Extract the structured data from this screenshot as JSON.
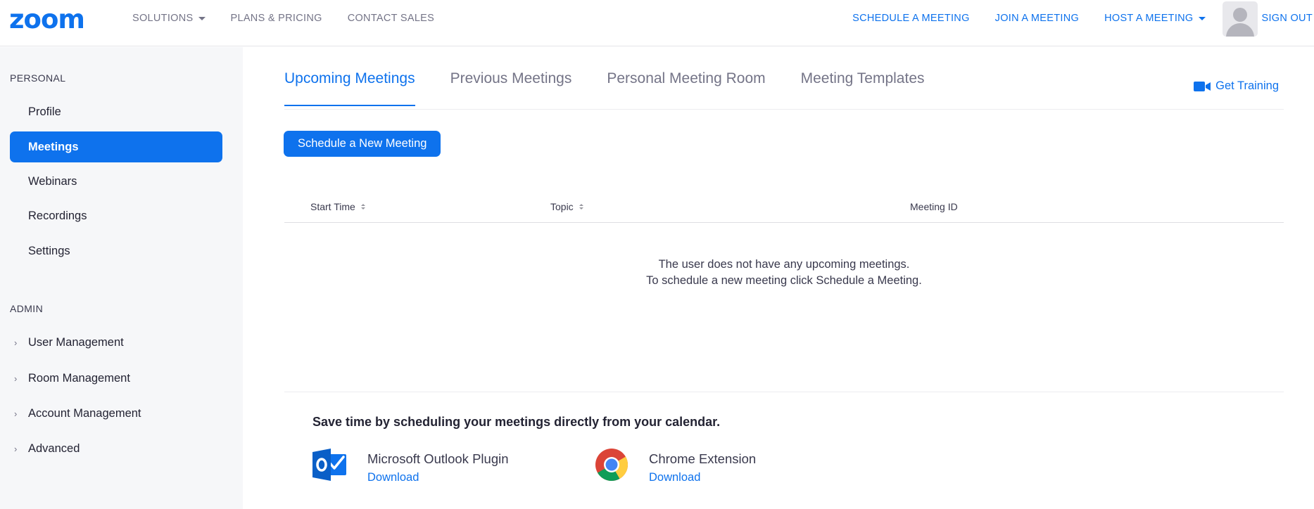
{
  "header": {
    "logo": "zoom",
    "nav_left": [
      {
        "label": "SOLUTIONS",
        "dropdown": true
      },
      {
        "label": "PLANS & PRICING",
        "dropdown": false
      },
      {
        "label": "CONTACT SALES",
        "dropdown": false
      }
    ],
    "nav_right": {
      "schedule": "SCHEDULE A MEETING",
      "join": "JOIN A MEETING",
      "host": "HOST A MEETING",
      "sign_out": "SIGN OUT"
    }
  },
  "sidebar": {
    "personal_label": "PERSONAL",
    "personal_items": [
      {
        "label": "Profile",
        "active": false
      },
      {
        "label": "Meetings",
        "active": true
      },
      {
        "label": "Webinars",
        "active": false
      },
      {
        "label": "Recordings",
        "active": false
      },
      {
        "label": "Settings",
        "active": false
      }
    ],
    "admin_label": "ADMIN",
    "admin_items": [
      {
        "label": "User Management"
      },
      {
        "label": "Room Management"
      },
      {
        "label": "Account Management"
      },
      {
        "label": "Advanced"
      }
    ]
  },
  "main": {
    "tabs": [
      {
        "label": "Upcoming Meetings",
        "active": true
      },
      {
        "label": "Previous Meetings",
        "active": false
      },
      {
        "label": "Personal Meeting Room",
        "active": false
      },
      {
        "label": "Meeting Templates",
        "active": false
      }
    ],
    "get_training": "Get Training",
    "schedule_button": "Schedule a New Meeting",
    "table": {
      "columns": [
        "Start Time",
        "Topic",
        "Meeting ID"
      ],
      "empty_line1": "The user does not have any upcoming meetings.",
      "empty_line2": "To schedule a new meeting click Schedule a Meeting."
    },
    "calendar": {
      "title": "Save time by scheduling your meetings directly from your calendar.",
      "plugins": [
        {
          "name": "Microsoft Outlook Plugin",
          "link": "Download",
          "icon": "outlook-icon"
        },
        {
          "name": "Chrome Extension",
          "link": "Download",
          "icon": "chrome-icon"
        }
      ]
    }
  },
  "colors": {
    "accent": "#0e72ed",
    "sidebar_bg": "#f6f7f9",
    "text_primary": "#232333",
    "text_muted": "#747487"
  }
}
